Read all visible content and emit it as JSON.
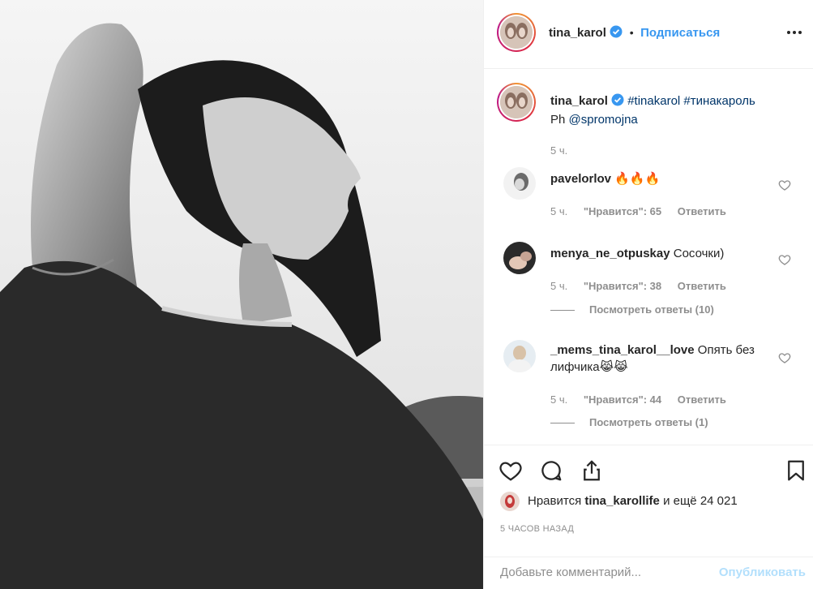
{
  "post": {
    "author": "tina_karol",
    "follow_label": "Подписаться",
    "dot": "•"
  },
  "caption": {
    "author": "tina_karol",
    "hashtags": "#tinakarol #тинакароль",
    "prefix": "Ph ",
    "mention": "@spromojna",
    "time": "5 ч."
  },
  "comments": [
    {
      "user": "pavelorlov",
      "text": "🔥🔥🔥",
      "time": "5 ч.",
      "likes": "\"Нравится\": 65",
      "reply": "Ответить",
      "replies": ""
    },
    {
      "user": "menya_ne_otpuskay",
      "text": "Сосочки)",
      "time": "5 ч.",
      "likes": "\"Нравится\": 38",
      "reply": "Ответить",
      "replies": "Посмотреть ответы (10)"
    },
    {
      "user": "_mems_tina_karol__love",
      "text": "Опять без лифчика😹😹",
      "time": "5 ч.",
      "likes": "\"Нравится\": 44",
      "reply": "Ответить",
      "replies": "Посмотреть ответы (1)"
    }
  ],
  "likes": {
    "prefix": "Нравится ",
    "user": "tina_karollife",
    "suffix": " и ещё 24 021"
  },
  "timestamp": "5 ЧАСОВ НАЗАД",
  "add_comment": {
    "placeholder": "Добавьте комментарий...",
    "publish_label": "Опубликовать"
  },
  "colors": {
    "link": "#003569",
    "follow": "#3897f0",
    "muted": "#8e8e8e",
    "publish_disabled": "#b2dffc"
  },
  "icons": {
    "verified": "verified-badge-icon",
    "more": "more-options-icon",
    "like": "heart-icon",
    "comment": "comment-bubble-icon",
    "share": "share-icon",
    "save": "bookmark-icon"
  }
}
